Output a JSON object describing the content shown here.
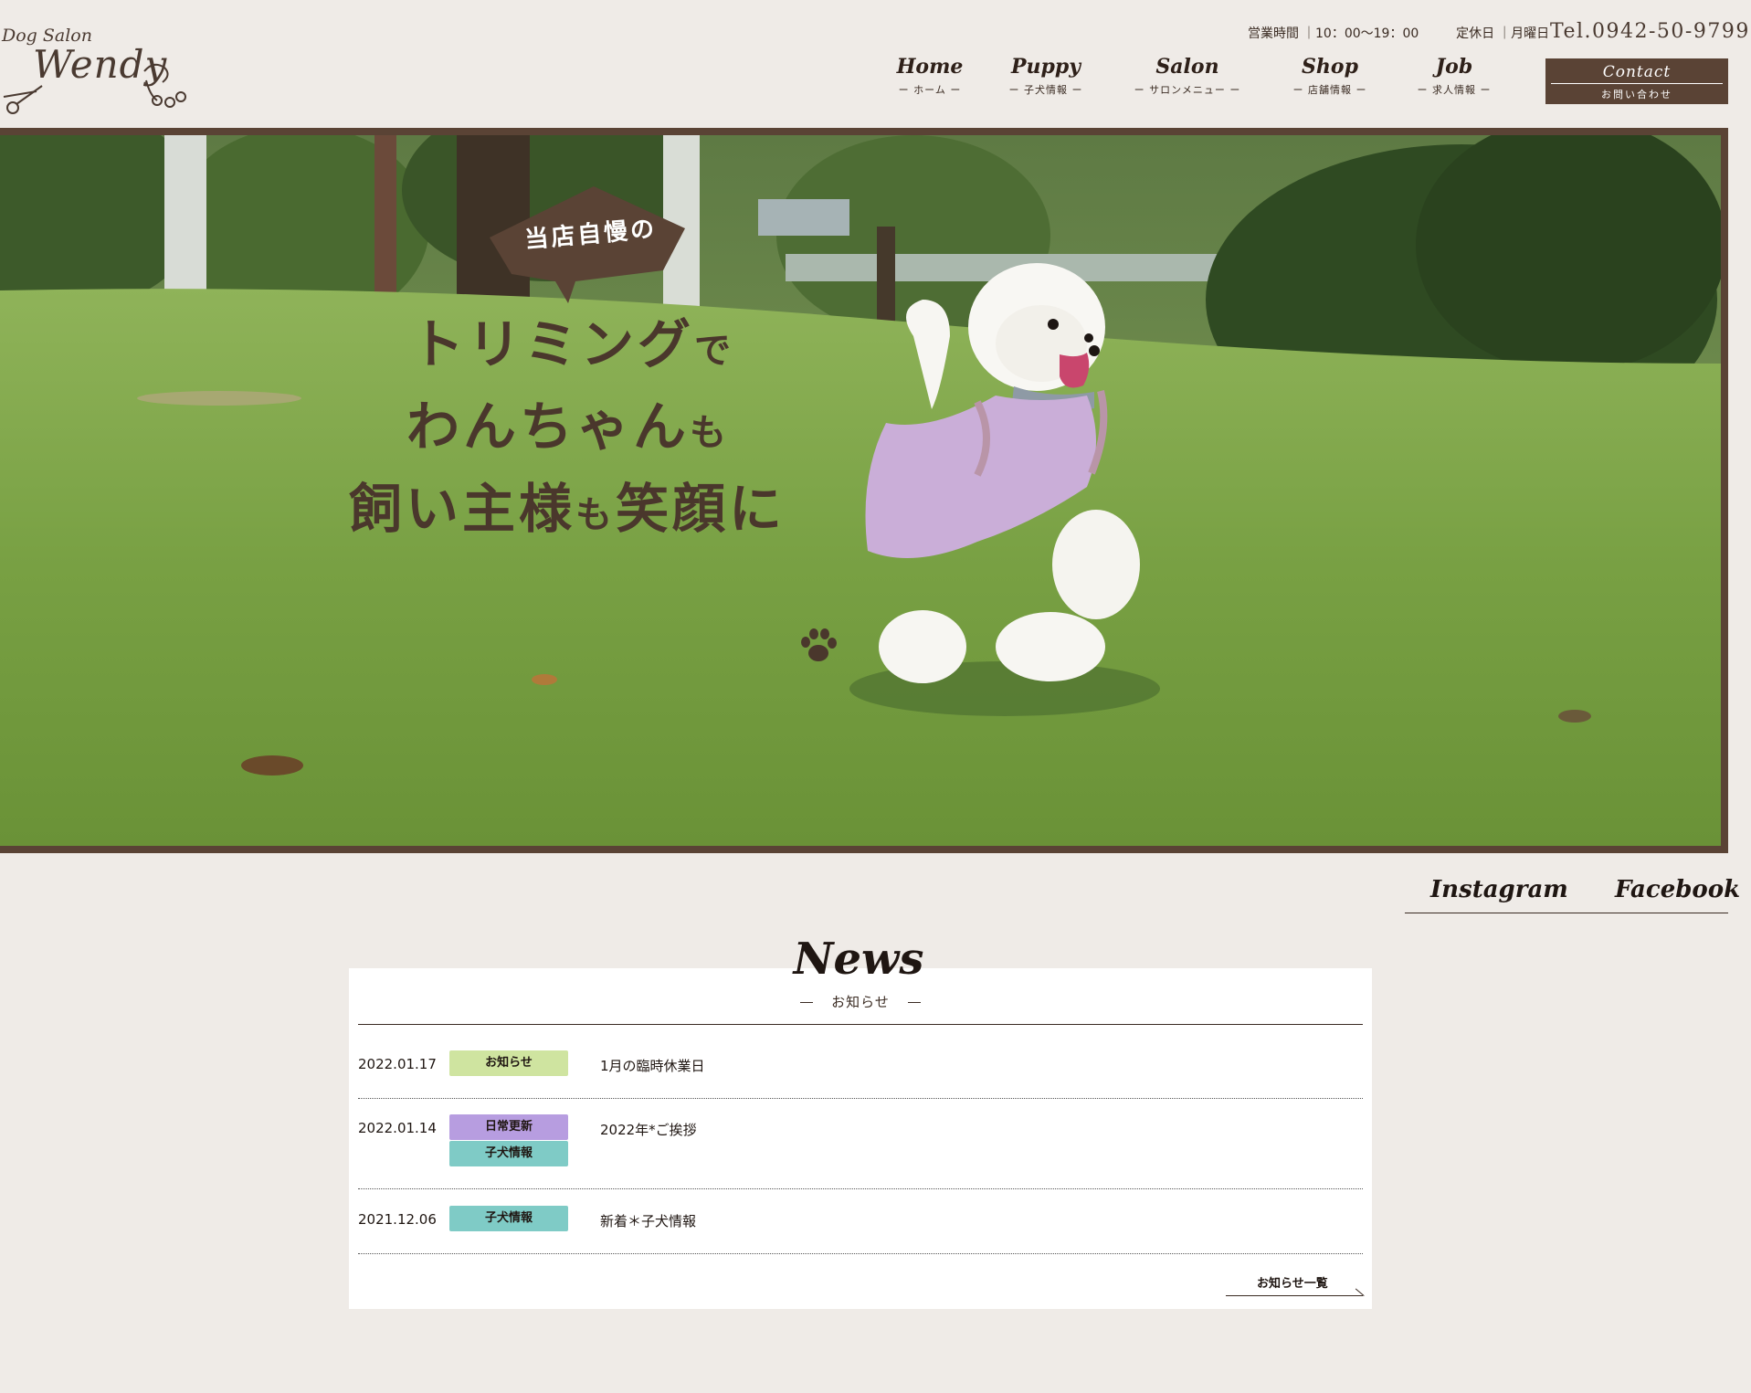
{
  "brand": {
    "small": "Dog Salon",
    "big": "Wendy"
  },
  "info": {
    "hours_label": "営業時間",
    "hours": "10：00〜19：00",
    "closed_label": "定休日",
    "closed": "月曜日",
    "tel": "Tel.0942-50-9799"
  },
  "nav": [
    {
      "en": "Home",
      "jp": "ー ホーム ー"
    },
    {
      "en": "Puppy",
      "jp": "ー 子犬情報 ー"
    },
    {
      "en": "Salon",
      "jp": "ー サロンメニュー ー"
    },
    {
      "en": "Shop",
      "jp": "ー 店舗情報 ー"
    },
    {
      "en": "Job",
      "jp": "ー 求人情報 ー"
    }
  ],
  "contact": {
    "en": "Contact",
    "jp": "お問い合わせ"
  },
  "hero": {
    "badge": "当店自慢の",
    "line1_main": "トリミング",
    "line1_small": "で",
    "line2_main": "わんちゃん",
    "line2_small": "も",
    "line3_a": "飼い主様",
    "line3_b": "も",
    "line3_c": "笑顔に"
  },
  "social": {
    "instagram": "Instagram",
    "facebook": "Facebook"
  },
  "news": {
    "title": "News",
    "subtitle": "お知らせ",
    "items": [
      {
        "date": "2022.01.17",
        "tags": [
          "お知らせ"
        ],
        "title": "1月の臨時休業日"
      },
      {
        "date": "2022.01.14",
        "tags": [
          "日常更新",
          "子犬情報"
        ],
        "title": "2022年*ご挨拶"
      },
      {
        "date": "2021.12.06",
        "tags": [
          "子犬情報"
        ],
        "title": "新着＊子犬情報"
      }
    ],
    "more": "お知らせ一覧"
  },
  "colors": {
    "background": "#efebe7",
    "brown": "#5a4335",
    "tag_green": "#cfe4a0",
    "tag_purple": "#b79de0",
    "tag_teal": "#7fcbc6"
  }
}
